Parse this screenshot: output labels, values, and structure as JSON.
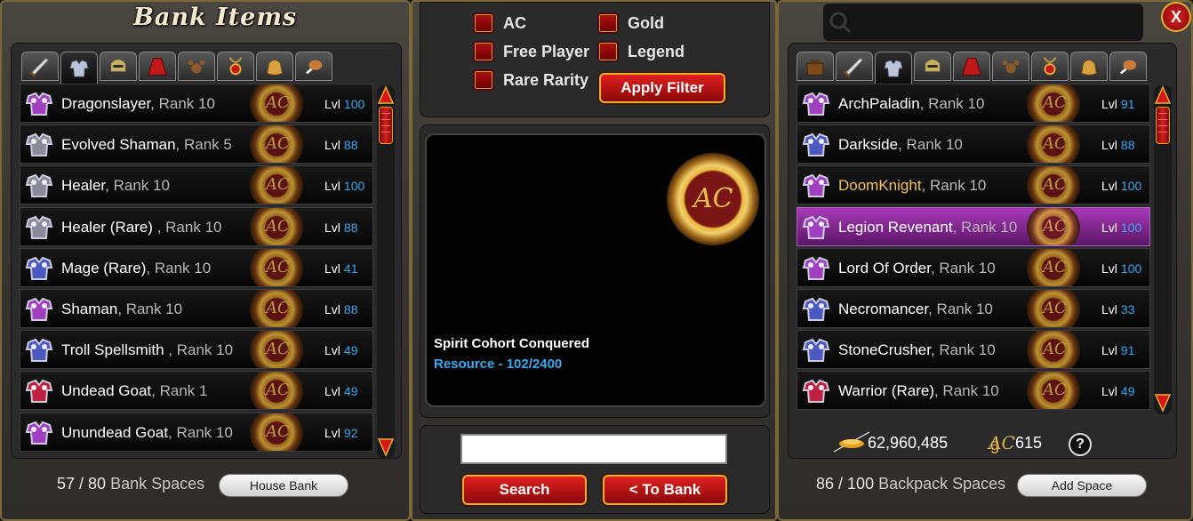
{
  "bank": {
    "title": "Bank Items",
    "tabs": [
      "sword-icon",
      "armor-icon",
      "helmet-icon",
      "cape-icon",
      "pet-icon",
      "amulet-icon",
      "bag-icon",
      "food-icon"
    ],
    "active_tab": 1,
    "items": [
      {
        "name": "Dragonslayer",
        "rank": ", Rank 10",
        "lvl": "100",
        "icon_color": "#a040c0"
      },
      {
        "name": "Evolved Shaman",
        "rank": ", Rank 5",
        "lvl": "88",
        "icon_color": "#8a8a9a"
      },
      {
        "name": "Healer",
        "rank": ", Rank 10",
        "lvl": "100",
        "icon_color": "#8a8a9a"
      },
      {
        "name": "Healer (Rare)",
        "rank": " , Rank 10",
        "lvl": "88",
        "icon_color": "#8a8a9a"
      },
      {
        "name": "Mage (Rare)",
        "rank": ", Rank 10",
        "lvl": "41",
        "icon_color": "#4a5ac0"
      },
      {
        "name": "Shaman",
        "rank": ", Rank 10",
        "lvl": "88",
        "icon_color": "#a040c0"
      },
      {
        "name": "Troll Spellsmith",
        "rank": " , Rank 10",
        "lvl": "49",
        "icon_color": "#4a5ac0"
      },
      {
        "name": "Undead Goat",
        "rank": ", Rank 1",
        "lvl": "49",
        "icon_color": "#c02040"
      },
      {
        "name": "Unundead Goat",
        "rank": ", Rank 10",
        "lvl": "92",
        "icon_color": "#a040c0"
      }
    ],
    "lvl_label": "Lvl",
    "spaces_used": "57",
    "spaces_sep": " / ",
    "spaces_total": "80",
    "spaces_label": " Bank Spaces",
    "house_bank_label": "House Bank"
  },
  "filters": {
    "options": [
      {
        "label": "AC"
      },
      {
        "label": "Gold"
      },
      {
        "label": "Free Player"
      },
      {
        "label": "Legend"
      },
      {
        "label": "Rare Rarity"
      }
    ],
    "apply_label": "Apply Filter"
  },
  "preview": {
    "item_name": "Spirit Cohort Conquered",
    "item_type": "Resource - 102/2400",
    "coin_text": "AC"
  },
  "search": {
    "value": "",
    "search_label": "Search",
    "to_bank_label": "< To Bank"
  },
  "backpack": {
    "tabs": [
      "bag-brown-icon",
      "sword-icon",
      "armor-icon",
      "helmet-icon",
      "cape-icon",
      "pet-icon",
      "amulet-icon",
      "bag-icon",
      "food-icon"
    ],
    "active_tab": 2,
    "items": [
      {
        "name": "ArchPaladin",
        "rank": ", Rank 10",
        "lvl": "91",
        "icon_color": "#a040c0",
        "gold": false,
        "selected": false
      },
      {
        "name": "Darkside",
        "rank": ", Rank 10",
        "lvl": "88",
        "icon_color": "#4a5ac0",
        "gold": false,
        "selected": false
      },
      {
        "name": "DoomKnight",
        "rank": ", Rank 10",
        "lvl": "100",
        "icon_color": "#a040c0",
        "gold": true,
        "selected": false
      },
      {
        "name": "Legion Revenant",
        "rank": ", Rank 10",
        "lvl": "100",
        "icon_color": "#a040c0",
        "gold": false,
        "selected": true
      },
      {
        "name": "Lord Of Order",
        "rank": ", Rank 10",
        "lvl": "100",
        "icon_color": "#a040c0",
        "gold": false,
        "selected": false
      },
      {
        "name": "Necromancer",
        "rank": ", Rank 10",
        "lvl": "33",
        "icon_color": "#4a5ac0",
        "gold": false,
        "selected": false
      },
      {
        "name": "StoneCrusher",
        "rank": ", Rank 10",
        "lvl": "91",
        "icon_color": "#4a5ac0",
        "gold": false,
        "selected": false
      },
      {
        "name": "Warrior (Rare)",
        "rank": ", Rank 10",
        "lvl": "49",
        "icon_color": "#c02040",
        "gold": false,
        "selected": false
      }
    ],
    "lvl_label": "Lvl",
    "gold_amount": "62,960,485",
    "gold_suffix": "g",
    "ac_amount": "615",
    "ac_label": "AC",
    "help_label": "?",
    "spaces_used": "86",
    "spaces_sep": " / ",
    "spaces_total": "100",
    "spaces_label": " Backpack Spaces",
    "add_space_label": "Add Space",
    "search_placeholder": ""
  },
  "close_label": "X",
  "colors": {
    "accent_red": "#d81818",
    "gold": "#e6b030",
    "level_blue": "#3aa8f0",
    "selected_purple": "#8a2a9a"
  }
}
